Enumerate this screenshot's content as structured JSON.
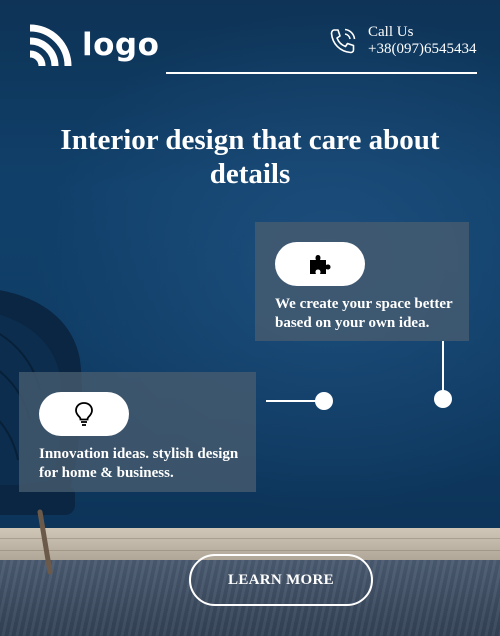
{
  "header": {
    "logo_text": "logo",
    "logo_icon": "wifi-arcs-icon",
    "contact_label": "Call Us",
    "phone_number": "+38(097)6545434",
    "phone_icon": "phone-ringing-icon"
  },
  "hero": {
    "title": "Interior design that care about details"
  },
  "features": [
    {
      "icon": "puzzle-piece-icon",
      "text": "We create your space better based on your own idea."
    },
    {
      "icon": "lightbulb-icon",
      "text": "Innovation ideas. stylish design for home & business."
    }
  ],
  "cta": {
    "label": "LEARN MORE"
  },
  "colors": {
    "background": "#0f3d66",
    "card": "#485c70",
    "text": "#ffffff"
  }
}
